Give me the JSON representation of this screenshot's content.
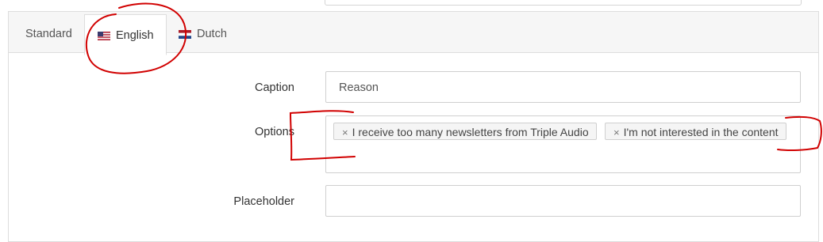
{
  "tabs": [
    {
      "label": "Standard",
      "active": false,
      "flag": null
    },
    {
      "label": "English",
      "active": true,
      "flag": "us-flag-icon"
    },
    {
      "label": "Dutch",
      "active": false,
      "flag": "nl-flag-icon"
    }
  ],
  "form": {
    "caption": {
      "label": "Caption",
      "value": "Reason"
    },
    "options": {
      "label": "Options",
      "tags": [
        "I receive too many newsletters from Triple Audio",
        "I'm not interested in the content"
      ],
      "remove_glyph": "×"
    },
    "placeholder": {
      "label": "Placeholder",
      "value": ""
    }
  },
  "colors": {
    "annotation": "#d10000",
    "tab_bar": "#f6f6f6",
    "border": "#dddddd"
  }
}
